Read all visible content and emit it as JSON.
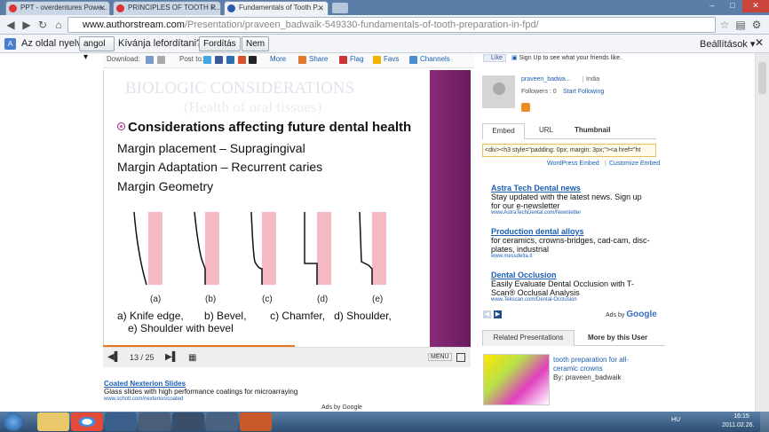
{
  "browser": {
    "tabs": [
      {
        "label": "PPT - overdentures Powe..."
      },
      {
        "label": "PRINCIPLES OF TOOTH P..."
      },
      {
        "label": "Fundamentals of Tooth P..."
      }
    ],
    "url_host": "www.authorstream.com",
    "url_path": "/Presentation/praveen_badwaik-549330-fundamentals-of-tooth-preparation-in-fpd/",
    "window_buttons": {
      "minimize": "–",
      "maximize": "□",
      "close": "✕"
    }
  },
  "translate_bar": {
    "prefix": "Az oldal nyelve",
    "language": "angol ▾",
    "question": "Kívánja lefordítani?",
    "translate_button": "Fordítás",
    "no_button": "Nem",
    "settings": "Beállítások ▾"
  },
  "toolbar": {
    "download_label": "Download:",
    "post_label": "Post to:",
    "more": "More",
    "share": "Share",
    "flag": "Flag",
    "favs": "Favs",
    "channels": "Channels"
  },
  "slide": {
    "ghost_title": "BIOLOGIC CONSIDERATIONS",
    "ghost_subtitle": "(Health of oral tissues)",
    "heading": "Considerations affecting future dental health",
    "lines": [
      "Margin placement – Supragingival",
      "Margin Adaptation – Recurrent caries",
      "Margin Geometry"
    ],
    "figure_labels": [
      "(a)",
      "(b)",
      "(c)",
      "(d)",
      "(e)"
    ],
    "caption_line1": "a) Knife edge,       b) Bevel,        c) Chamfer,   d) Shoulder,",
    "caption_line2": "e) Shoulder with bevel"
  },
  "player": {
    "page": "13 / 25",
    "menu": "MENU"
  },
  "bottom_ad": {
    "title": "Coated Nexterion Slides",
    "body": "Glass slides with high performance coatings for microarraying",
    "url": "www.schott.com/nexterion/coated",
    "adsby": "Ads by Google"
  },
  "sidebar": {
    "fb_like": "Like",
    "fb_text": "Sign Up to see what your friends like.",
    "user_name": "praveen_badwa...",
    "user_country": "India",
    "followers": "Followers : 0",
    "start_following": "Start Following",
    "embed_tabs": [
      "Embed",
      "URL",
      "Thumbnail"
    ],
    "embed_code": "<div><h3 style=\"padding: 0px; margin: 3px;\"><a href=\"ht",
    "wp_embed": "WordPress Embed",
    "customize_embed": "Customize Embed",
    "ads": [
      {
        "title": "Astra Tech Dental news",
        "body": "Stay updated with the latest news. Sign up for our e-newsletter",
        "url": "www.AstraTechDental.com/Newsletter"
      },
      {
        "title": "Production dental alloys",
        "body": "for ceramics, crowns-bridges, cad-cam, disc-plates, industrial",
        "url": "www.messdelta.it"
      },
      {
        "title": "Dental Occlusion",
        "body": "Easily Evaluate Dental Occlusion with T-Scan® Occlusal Analysis",
        "url": "www.Tekscan.com/Dental-Occlusion"
      }
    ],
    "ads_by": "Ads by",
    "google": "Google",
    "related_tabs": [
      "Related Presentations",
      "More by this User"
    ],
    "related": {
      "title": "tooth preparation for all-ceramic crowns",
      "by": "By: praveen_badwaik"
    }
  },
  "taskbar": {
    "lang": "HU",
    "time": "16:15",
    "date": "2011.02.26."
  },
  "colors": {
    "accent": "#1a5fb4",
    "slide_pink": "#f4b9c2",
    "slide_purple": "#7a2470",
    "progress": "#e87722"
  }
}
